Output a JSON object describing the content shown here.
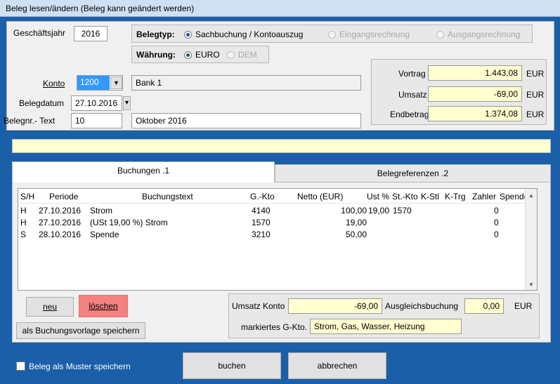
{
  "window": {
    "title": "Beleg lesen/ändern (Beleg kann geändert werden)"
  },
  "header": {
    "geschaeftsjahr_label": "Geschäftsjahr",
    "geschaeftsjahr_value": "2016",
    "belegtyp_label": "Belegtyp:",
    "belegtyp_options": [
      "Sachbuchung / Kontoauszug",
      "Eingangsrechnung",
      "Ausgangsrechnung"
    ],
    "belegtyp_selected": "Sachbuchung / Kontoauszug",
    "waehrung_label": "Währung:",
    "waehrung_options": [
      "EURO",
      "DEM"
    ],
    "waehrung_selected": "EURO"
  },
  "account": {
    "konto_label": "Konto",
    "konto_value": "1200",
    "konto_name": "Bank 1",
    "belegdatum_label": "Belegdatum",
    "belegdatum_value": "27.10.2016",
    "belegnr_label": "Belegnr.- Text",
    "belegnr_value": "10",
    "belegtext_value": "Oktober 2016"
  },
  "totals": {
    "vortrag_label": "Vortrag",
    "vortrag_value": "1.443,08",
    "umsatz_label": "Umsatz",
    "umsatz_value": "-69,00",
    "endbetrag_label": "Endbetrag",
    "endbetrag_value": "1.374,08",
    "currency": "EUR"
  },
  "tabs": [
    {
      "label": "Buchungen .1",
      "active": true
    },
    {
      "label": "Belegreferenzen .2",
      "active": false
    }
  ],
  "table": {
    "columns": [
      "S/H",
      "Periode",
      "Buchungstext",
      "G.-Kto",
      "Netto (EUR)",
      "Ust %",
      "St.-Kto",
      "K-Stl",
      "K-Trg",
      "Zahler",
      "Spender"
    ],
    "rows": [
      {
        "sh": "H",
        "periode": "27.10.2016",
        "text": "Strom",
        "gkto": "4140",
        "netto": "100,00",
        "ust": "19,00",
        "stkto": "1570",
        "kstl": "",
        "ktrg": "",
        "zahler": "0",
        "spender": ""
      },
      {
        "sh": "H",
        "periode": "27.10.2016",
        "text": "(USt 19,00 %) Strom",
        "gkto": "1570",
        "netto": "19,00",
        "ust": "",
        "stkto": "",
        "kstl": "",
        "ktrg": "",
        "zahler": "0",
        "spender": ""
      },
      {
        "sh": "S",
        "periode": "28.10.2016",
        "text": "Spende",
        "gkto": "3210",
        "netto": "50,00",
        "ust": "",
        "stkto": "",
        "kstl": "",
        "ktrg": "",
        "zahler": "0",
        "spender": ""
      }
    ]
  },
  "actions": {
    "neu": "neu",
    "loeschen": "löschen",
    "vorlage": "als Buchungsvorlage speichern"
  },
  "summary": {
    "umsatz_konto_label": "Umsatz Konto",
    "umsatz_konto_value": "-69,00",
    "ausgleich_label": "Ausgleichsbuchung",
    "ausgleich_value": "0,00",
    "currency": "EUR",
    "markiertes_label": "markiertes G-Kto.",
    "markiertes_value": "Strom, Gas, Wasser, Heizung"
  },
  "footer": {
    "muster_label": "Beleg als Muster speichern",
    "buchen": "buchen",
    "abbrechen": "abbrechen"
  },
  "colors": {
    "window_bg": "#1a5fa8",
    "yellow_field": "#ffffd0",
    "delete_button": "#f48080",
    "selected_konto": "#3399ff"
  }
}
